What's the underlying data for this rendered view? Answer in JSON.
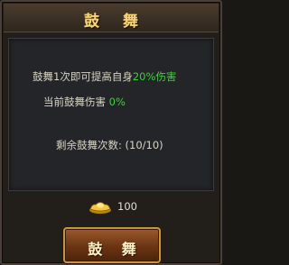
{
  "dialog": {
    "title": "鼓 舞"
  },
  "effect": {
    "prefix": "鼓舞1次即可提高自身",
    "bonus": "20%伤害"
  },
  "current": {
    "label": "当前鼓舞伤害",
    "value": "0%"
  },
  "remaining": {
    "label": "剩余鼓舞次数: ",
    "value": "(10/10)"
  },
  "cost": {
    "icon": "gold-ingot-icon",
    "amount": "100"
  },
  "button": {
    "label": "鼓 舞"
  },
  "colors": {
    "highlight": "#3fcf3a",
    "title": "#f3d77a"
  }
}
